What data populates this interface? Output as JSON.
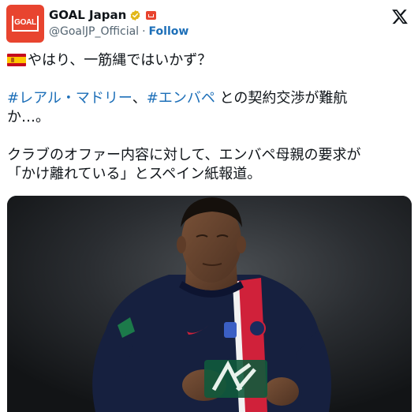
{
  "account": {
    "display_name": "GOAL Japan",
    "handle": "@GoalJP_Official",
    "separator": "·",
    "follow_label": "Follow",
    "avatar_text": "GOAL"
  },
  "icons": {
    "verified": "verified-badge-icon",
    "affiliate": "goal-affiliate-icon",
    "platform": "x-logo-icon",
    "flag": "spain-flag-icon"
  },
  "tweet": {
    "line1": "やはり、一筋縄ではいかず？",
    "hashtag1": "#レアル・マドリー",
    "sep1": "、",
    "hashtag2": "#エンバペ",
    "line2_rest": " との契約交渉が難航\nか…。",
    "line3": "クラブのオファー内容に対して、エンバペ母親の要求が\n「かけ離れている」とスペイン紙報道。"
  },
  "media": {
    "description": "photo"
  },
  "colors": {
    "link": "#1d6fb8",
    "brand": "#e8442f",
    "text": "#0f1419",
    "muted": "#536471"
  }
}
